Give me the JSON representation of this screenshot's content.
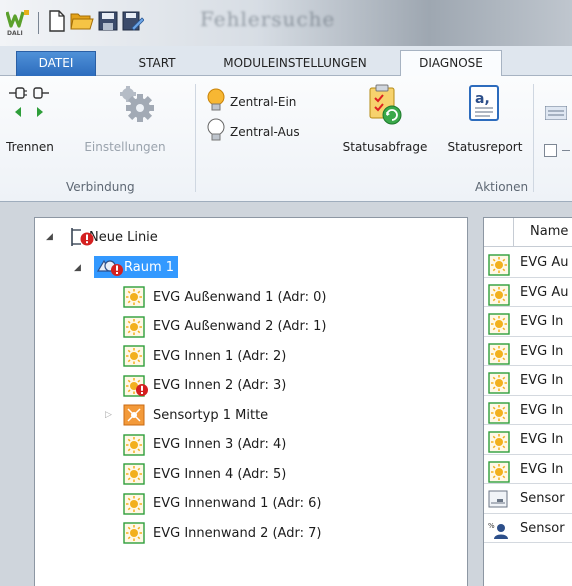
{
  "window": {
    "title": "Fehlersuche"
  },
  "quick_access": {
    "logo_text": "DALI",
    "icons": [
      "app-logo-icon",
      "new-document-icon",
      "open-folder-icon",
      "save-icon",
      "save-as-icon"
    ]
  },
  "ribbon_tabs": [
    {
      "label": "DATEI",
      "active": false,
      "file": true
    },
    {
      "label": "START",
      "active": false
    },
    {
      "label": "MODULEINSTELLUNGEN",
      "active": false
    },
    {
      "label": "DIAGNOSE",
      "active": true
    }
  ],
  "ribbon": {
    "groups": [
      {
        "label": "Verbindung"
      },
      {
        "label": "Aktionen"
      }
    ],
    "buttons": {
      "trennen": "Trennen",
      "einstellungen": "Einstellungen",
      "zentral_ein": "Zentral-Ein",
      "zentral_aus": "Zentral-Aus",
      "statusabfrage": "Statusabfrage",
      "statusreport": "Statusreport"
    }
  },
  "tree": {
    "root": {
      "label": "Neue Linie"
    },
    "room": {
      "label": "Raum 1"
    },
    "items": [
      {
        "label": "EVG Außenwand 1 (Adr: 0)",
        "type": "evg",
        "error": false
      },
      {
        "label": "EVG Außenwand 2 (Adr: 1)",
        "type": "evg",
        "error": false
      },
      {
        "label": "EVG Innen 1 (Adr: 2)",
        "type": "evg",
        "error": false
      },
      {
        "label": "EVG Innen 2 (Adr: 3)",
        "type": "evg",
        "error": true
      },
      {
        "label": "Sensortyp 1 Mitte",
        "type": "sensor",
        "error": false
      },
      {
        "label": "EVG Innen 3 (Adr: 4)",
        "type": "evg",
        "error": false
      },
      {
        "label": "EVG Innen 4 (Adr: 5)",
        "type": "evg",
        "error": false
      },
      {
        "label": "EVG Innenwand 1 (Adr: 6)",
        "type": "evg",
        "error": false
      },
      {
        "label": "EVG Innenwand 2 (Adr: 7)",
        "type": "evg",
        "error": false
      }
    ]
  },
  "list": {
    "header": "Name",
    "rows": [
      {
        "label": "EVG Au",
        "type": "evg"
      },
      {
        "label": "EVG Au",
        "type": "evg"
      },
      {
        "label": "EVG In",
        "type": "evg"
      },
      {
        "label": "EVG In",
        "type": "evg"
      },
      {
        "label": "EVG In",
        "type": "evg"
      },
      {
        "label": "EVG In",
        "type": "evg"
      },
      {
        "label": "EVG In",
        "type": "evg"
      },
      {
        "label": "EVG In",
        "type": "evg"
      },
      {
        "label": "Sensor",
        "type": "sensor-module"
      },
      {
        "label": "Sensor",
        "type": "sensor-user"
      }
    ]
  },
  "colors": {
    "file_tab": "#2d6cbd",
    "selection": "#3399ff",
    "evg_icon": "#f2b01e",
    "error": "#d42020",
    "connect_arrow": "#2e9e3a"
  }
}
